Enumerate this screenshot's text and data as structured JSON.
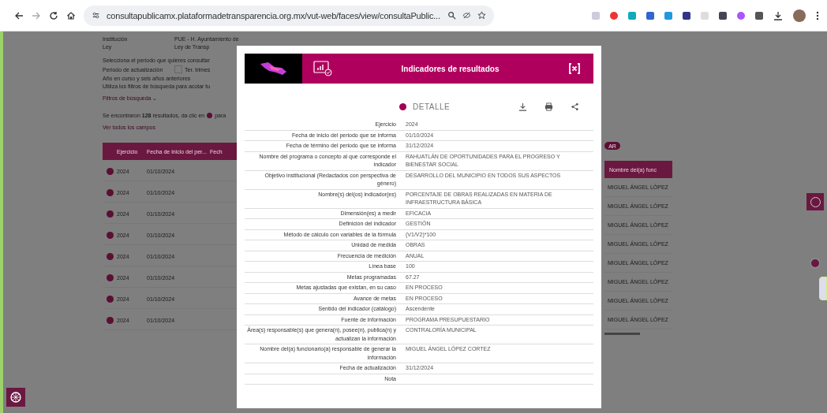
{
  "browser": {
    "url": "consultapublicamx.plataformadetransparencia.org.mx/vut-web/faces/view/consultaPublic..."
  },
  "page": {
    "fields": [
      {
        "label": "Institución",
        "value": "PUE - H. Ayuntamiento de"
      },
      {
        "label": "Ley",
        "value": "Ley de Transp"
      }
    ],
    "period_prompt": "Selecciona el periodo que quieres consultar",
    "period_label": "Periodo de actualización",
    "period_checkbox": {
      "label": "Ter. trimes",
      "checked": false
    },
    "period_note": "Año en curso y seis años anteriores",
    "filter_hint": "Utiliza los filtros de búsqueda para acotar tu",
    "filters_link": "Filtros de búsqueda ⌄",
    "results_text": "Se encontraron **128** resultados, da clic en",
    "results_tail": "para",
    "search_button": "AR",
    "all_fields_link": "Ver todos los campos",
    "table": {
      "columns": [
        "Ejercicio",
        "Fecha de inicio del per...",
        "Fech"
      ],
      "last_column": "Nombre del(a) func",
      "rows": [
        {
          "year": "2024",
          "date": "01/10/2024",
          "name": "MIGUEL ÁNGEL LÓPEZ"
        },
        {
          "year": "2024",
          "date": "01/10/2024",
          "name": "MIGUEL ÁNGEL LÓPEZ"
        },
        {
          "year": "2024",
          "date": "01/10/2024",
          "name": "MIGUEL ÁNGEL LÓPEZ"
        },
        {
          "year": "2024",
          "date": "01/10/2024",
          "name": "MIGUEL ÁNGEL LÓPEZ"
        },
        {
          "year": "2024",
          "date": "01/10/2024",
          "name": "MIGUEL ÁNGEL LÓPEZ"
        },
        {
          "year": "2024",
          "date": "01/10/2024",
          "name": "MIGUEL ÁNGEL LÓPEZ"
        },
        {
          "year": "2024",
          "date": "01/10/2024",
          "name": "MIGUEL ÁNGEL LÓPEZ"
        },
        {
          "year": "2024",
          "date": "01/10/2024",
          "name": "MIGUEL ÁNGEL LÓPEZ"
        }
      ]
    }
  },
  "modal": {
    "title": "Indicadores de resultados",
    "section": "DETALLE",
    "rows": [
      {
        "label": "Ejercicio",
        "value": "2024"
      },
      {
        "label": "Fecha de inicio del periodo que se informa",
        "value": "01/10/2024"
      },
      {
        "label": "Fecha de término del periodo que se informa",
        "value": "31/12/2024"
      },
      {
        "label": "Nombre del programa o concepto al que corresponde el indicador",
        "value": "RAHUATLÁN DE OPORTUNIDADES PARA EL PROGRESO Y BIENESTAR SOCIAL"
      },
      {
        "label": "Objetivo institucional (Redactados con perspectiva de género)",
        "value": "DESARROLLO DEL MUNICIPIO EN TODOS SUS ASPECTOS"
      },
      {
        "label": "Nombre(s) del(os) indicador(es)",
        "value": "PORCENTAJE DE OBRAS REALIZADAS EN MATERIA DE INFRAESTRUCTURA BÁSICA"
      },
      {
        "label": "Dimensión(es) a medir",
        "value": "EFICACIA"
      },
      {
        "label": "Definición del indicador",
        "value": "GESTIÓN"
      },
      {
        "label": "Método de cálculo con variables de la fórmula",
        "value": "(V1/V2)*100"
      },
      {
        "label": "Unidad de medida",
        "value": "OBRAS"
      },
      {
        "label": "Frecuencia de medición",
        "value": "ANUAL"
      },
      {
        "label": "Línea base",
        "value": "100"
      },
      {
        "label": "Metas programadas",
        "value": "67.27"
      },
      {
        "label": "Metas ajustadas que existan, en su caso",
        "value": "EN PROCESO"
      },
      {
        "label": "Avance de metas",
        "value": "EN PROCESO"
      },
      {
        "label": "Sentido del indicador (catálogo)",
        "value": "Ascendente"
      },
      {
        "label": "Fuente de información",
        "value": "PROGRAMA PRESUPUESTARIO"
      },
      {
        "label": "Área(s) responsable(s) que genera(n), posee(n), publica(n) y actualizan la información",
        "value": "CONTRALORÍA MUNICIPAL"
      },
      {
        "label": "Nombre del(a) funcionario(a) responsable de generar la información",
        "value": "MIGUEL ÁNGEL LÓPEZ CORTEZ"
      },
      {
        "label": "Fecha de actualización",
        "value": "31/12/2024"
      },
      {
        "label": "Nota"
      }
    ]
  }
}
